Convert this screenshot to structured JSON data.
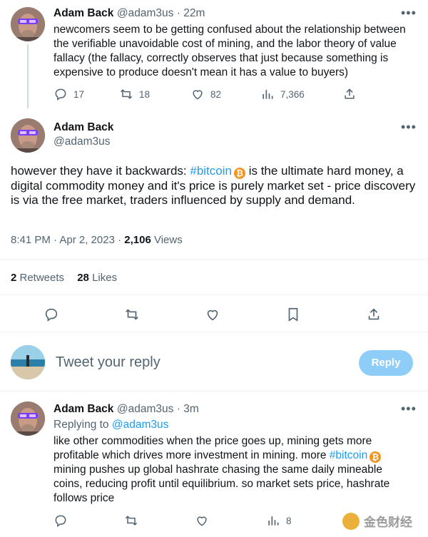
{
  "tweet1": {
    "name": "Adam Back",
    "handle": "@adam3us",
    "time": "· 22m",
    "text": "newcomers seem to be getting confused about the relationship between the verifiable unavoidable cost of mining, and the labor theory of value fallacy (the fallacy, correctly observes that just because something is expensive to produce doesn't mean it has a value to buyers)",
    "metrics": {
      "replies": "17",
      "retweets": "18",
      "likes": "82",
      "views": "7,366"
    },
    "more": "•••"
  },
  "tweet2": {
    "name": "Adam Back",
    "handle": "@adam3us",
    "text_before": "however they have it backwards: ",
    "hashtag": "#bitcoin",
    "text_after": " is the ultimate hard money, a digital commodity money and it's price is purely market set - price discovery is via the free market, traders influenced by supply and demand.",
    "datetime": "8:41 PM · Apr 2, 2023 · ",
    "views_count": "2,106",
    "views_label": " Views",
    "retweets_count": "2",
    "retweets_label": " Retweets",
    "likes_count": "28",
    "likes_label": " Likes",
    "more": "•••"
  },
  "reply_box": {
    "placeholder": "Tweet your reply",
    "button": "Reply"
  },
  "tweet3": {
    "name": "Adam Back",
    "handle": "@adam3us",
    "time": "· 3m",
    "replying_label": "Replying to ",
    "replying_to": "@adam3us",
    "text_before": "like other commodities when the price goes up, mining gets more profitable which drives more investment in mining. more ",
    "hashtag": "#bitcoin",
    "text_after": " mining pushes up global hashrate chasing the same daily mineable coins, reducing profit until equilibrium. so market sets price, hashrate follows price",
    "metrics": {
      "views": "8"
    },
    "more": "•••"
  },
  "watermark": {
    "text": "金色财经"
  },
  "colors": {
    "accent": "#1d9bf0",
    "reply_button": "#8ecdf8",
    "bitcoin": "#f7931a",
    "muted": "#536471"
  }
}
